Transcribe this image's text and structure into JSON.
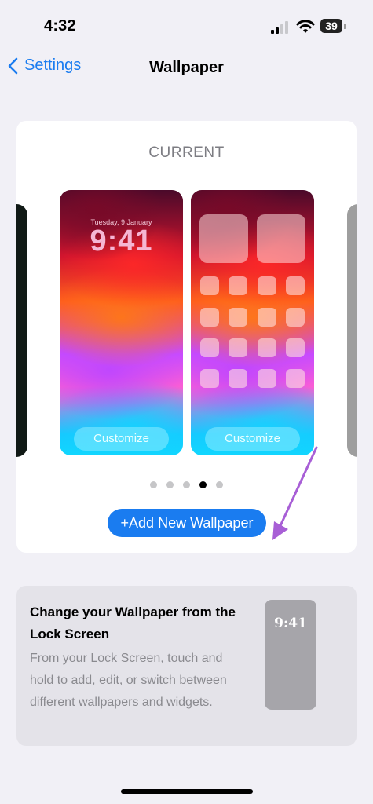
{
  "status_bar": {
    "time": "4:32",
    "battery": "39"
  },
  "nav": {
    "back_label": "Settings",
    "title": "Wallpaper"
  },
  "wallpaper_card": {
    "section_label": "CURRENT",
    "lock_screen": {
      "date": "Tuesday, 9 January",
      "time": "9:41",
      "customize_label": "Customize"
    },
    "home_screen": {
      "customize_label": "Customize"
    },
    "page_count": 5,
    "active_page_index": 3,
    "add_button_label": "+Add New Wallpaper"
  },
  "info_card": {
    "title": "Change your Wallpaper from the Lock Screen",
    "body": "From your Lock Screen, touch and hold to add, edit, or switch between different wallpapers and widgets.",
    "preview_time": "9:41"
  },
  "colors": {
    "accent": "#1a7cf0",
    "annotation_arrow": "#a85fd6",
    "background": "#f1f0f6"
  }
}
